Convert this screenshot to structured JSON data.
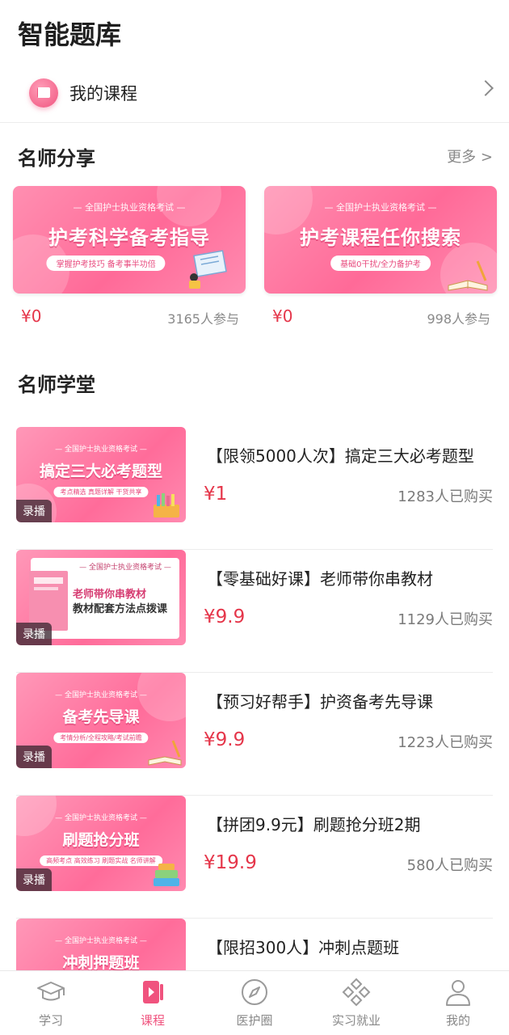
{
  "page": {
    "title": "智能题库"
  },
  "my_course": {
    "label": "我的课程"
  },
  "share_section": {
    "title": "名师分享",
    "more": "更多 >",
    "cards": [
      {
        "banner_top": "— 全国护士执业资格考试 —",
        "banner_title": "护考科学备考指导",
        "banner_sub": "掌握护考技巧  备考事半功倍",
        "price": "¥0",
        "count": "3165人参与"
      },
      {
        "banner_top": "— 全国护士执业资格考试 —",
        "banner_title": "护考课程任你搜索",
        "banner_sub": "基础0干扰/全力备护考",
        "price": "¥0",
        "count": "998人参与"
      }
    ]
  },
  "academy_section": {
    "title": "名师学堂",
    "courses": [
      {
        "thumb_top": "— 全国护士执业资格考试 —",
        "thumb_title": "搞定三大必考题型",
        "thumb_sub": "考点精选  真题详解  干货共享",
        "badge": "录播",
        "title": "【限领5000人次】搞定三大必考题型",
        "price": "¥1",
        "sold": "1283人已购买"
      },
      {
        "thumb_top": "— 全国护士执业资格考试 —",
        "thumb_title": "老师带你串教材",
        "thumb_sub": "教材配套方法点拨课",
        "badge": "录播",
        "title": "【零基础好课】老师带你串教材",
        "price": "¥9.9",
        "sold": "1129人已购买"
      },
      {
        "thumb_top": "— 全国护士执业资格考试 —",
        "thumb_title": "备考先导课",
        "thumb_sub": "考情分析/全程攻略/考试前瞻",
        "badge": "录播",
        "title": "【预习好帮手】护资备考先导课",
        "price": "¥9.9",
        "sold": "1223人已购买"
      },
      {
        "thumb_top": "— 全国护士执业资格考试 —",
        "thumb_title": "刷题抢分班",
        "thumb_sub": "高频考点  高效练习  刷题实战  名师讲解",
        "badge": "录播",
        "title": "【拼团9.9元】刷题抢分班2期",
        "price": "¥19.9",
        "sold": "580人已购买"
      },
      {
        "thumb_top": "— 全国护士执业资格考试 —",
        "thumb_title": "冲刺押题班",
        "thumb_sub": "",
        "badge": "",
        "title": "【限招300人】冲刺点题班",
        "price": "",
        "sold": ""
      }
    ]
  },
  "tabbar": {
    "active_color": "#f0537e",
    "items": [
      {
        "label": "学习",
        "icon": "graduation-cap-icon"
      },
      {
        "label": "课程",
        "icon": "course-icon"
      },
      {
        "label": "医护圈",
        "icon": "compass-icon"
      },
      {
        "label": "实习就业",
        "icon": "internship-icon"
      },
      {
        "label": "我的",
        "icon": "user-icon"
      }
    ]
  }
}
